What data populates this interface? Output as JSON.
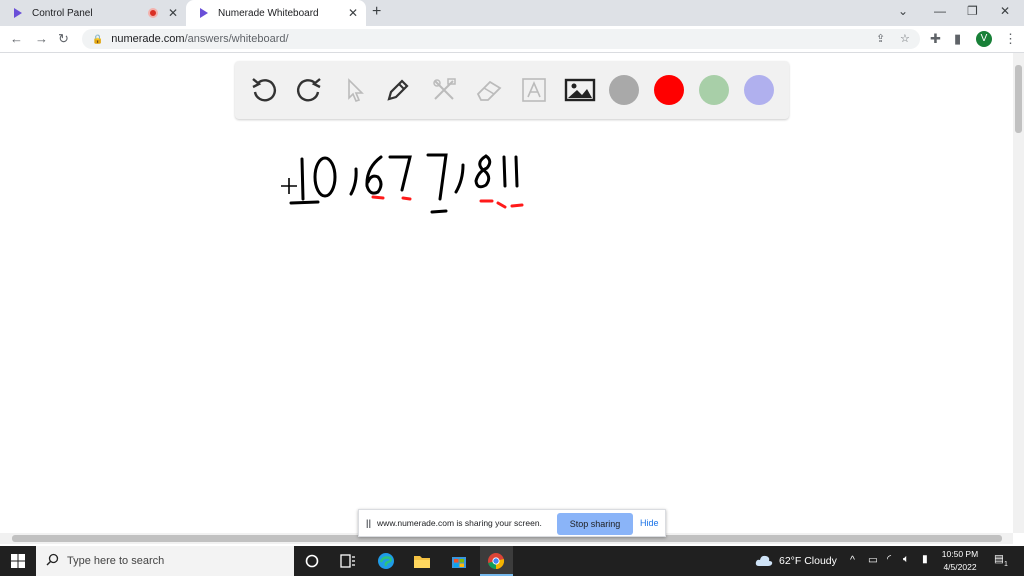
{
  "browser": {
    "tabs": [
      {
        "title": "Control Panel",
        "recording": true
      },
      {
        "title": "Numerade Whiteboard",
        "active": true
      }
    ],
    "url_host": "numerade.com",
    "url_path": "/answers/whiteboard/",
    "profile_initial": "V"
  },
  "whiteboard": {
    "tools": [
      "undo-icon",
      "redo-icon",
      "pointer-icon",
      "pen-icon",
      "tools-icon",
      "eraser-icon",
      "text-icon",
      "image-icon"
    ],
    "colors": [
      "#a9a9a9",
      "#ff0000",
      "#a8cfa8",
      "#b0b0ee"
    ],
    "handwriting": {
      "number": "10,677,811"
    }
  },
  "sharing_banner": {
    "message": "www.numerade.com is sharing your screen.",
    "stop_label": "Stop sharing",
    "hide_label": "Hide"
  },
  "taskbar": {
    "search_placeholder": "Type here to search",
    "weather": "62°F  Cloudy",
    "time": "10:50 PM",
    "date": "4/5/2022",
    "notification_count": "1"
  }
}
